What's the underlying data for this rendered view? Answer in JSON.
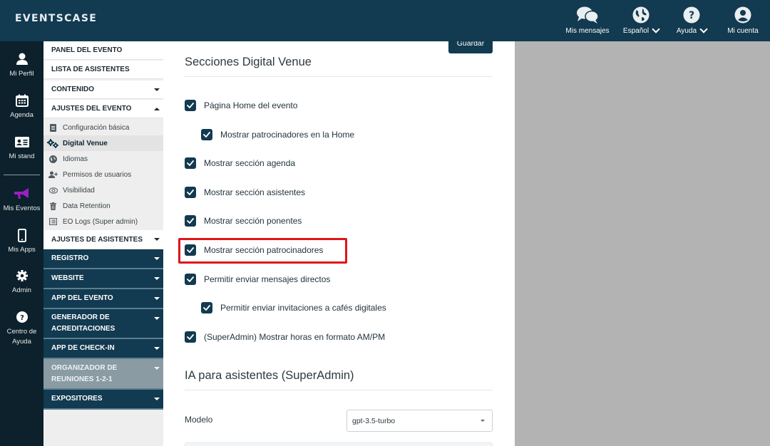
{
  "app": {
    "logo": "EVENTSCASE"
  },
  "topnav": [
    {
      "label": "Mis mensajes",
      "icon": "chat-bubbles-icon",
      "has_dropdown": false
    },
    {
      "label": "Español",
      "icon": "globe-icon",
      "has_dropdown": true
    },
    {
      "label": "Ayuda",
      "icon": "question-circle-icon",
      "has_dropdown": true
    },
    {
      "label": "Mi cuenta",
      "icon": "user-circle-icon",
      "has_dropdown": false
    }
  ],
  "leftrail": [
    {
      "label": "Mi Perfil",
      "icon": "user-icon"
    },
    {
      "label": "Agenda",
      "icon": "calendar-icon"
    },
    {
      "label": "Mi stand",
      "icon": "id-card-icon"
    },
    {
      "label": "Mis Eventos",
      "icon": "megaphone-icon",
      "active": true,
      "accent": "#9b1fc4"
    },
    {
      "label": "Mis Apps",
      "icon": "mobile-icon"
    },
    {
      "label": "Admin",
      "icon": "gear-icon"
    },
    {
      "label": "Centro de Ayuda",
      "icon": "question-circle-icon"
    }
  ],
  "sidenav": {
    "headers": [
      {
        "label": "PANEL DEL EVENTO"
      },
      {
        "label": "LISTA DE ASISTENTES"
      },
      {
        "label": "CONTENIDO",
        "expandable": true,
        "expanded": false
      },
      {
        "label": "AJUSTES DEL EVENTO",
        "expandable": true,
        "expanded": true
      }
    ],
    "subitems": [
      {
        "label": "Configuración básica",
        "icon": "document-icon"
      },
      {
        "label": "Digital Venue",
        "icon": "gears-icon",
        "active": true
      },
      {
        "label": "Idiomas",
        "icon": "globe-icon"
      },
      {
        "label": "Permisos de usuarios",
        "icon": "user-plus-icon"
      },
      {
        "label": "Visibilidad",
        "icon": "eye-icon"
      },
      {
        "label": "Data Retention",
        "icon": "trash-icon"
      },
      {
        "label": "EO Logs (Super admin)",
        "icon": "list-icon"
      }
    ],
    "asistentes_header": {
      "label": "AJUSTES DE ASISTENTES"
    },
    "dark_sections": [
      {
        "label": "REGISTRO"
      },
      {
        "label": "WEBSITE"
      },
      {
        "label": "APP DEL EVENTO"
      },
      {
        "label": "GENERADOR DE ACREDITACIONES"
      },
      {
        "label": "APP DE CHECK-IN"
      },
      {
        "label": "ORGANIZADOR DE REUNIONES 1-2-1",
        "disabled": true
      },
      {
        "label": "EXPOSITORES"
      }
    ]
  },
  "main": {
    "save_label": "Guardar",
    "section1_title": "Secciones Digital Venue",
    "options": [
      {
        "label": "Página Home del evento",
        "checked": true,
        "indent": 0
      },
      {
        "label": "Mostrar patrocinadores en la Home",
        "checked": true,
        "indent": 1
      },
      {
        "label": "Mostrar sección agenda",
        "checked": true,
        "indent": 0
      },
      {
        "label": "Mostrar sección asistentes",
        "checked": true,
        "indent": 0
      },
      {
        "label": "Mostrar sección ponentes",
        "checked": true,
        "indent": 0
      },
      {
        "label": "Mostrar sección patrocinadores",
        "checked": true,
        "indent": 0,
        "highlighted": true
      },
      {
        "label": "Permitir enviar mensajes directos",
        "checked": true,
        "indent": 0
      },
      {
        "label": "Permitir enviar invitaciones a cafés digitales",
        "checked": true,
        "indent": 1
      },
      {
        "label": "(SuperAdmin) Mostrar horas en formato AM/PM",
        "checked": true,
        "indent": 0
      }
    ],
    "section2_title": "IA para asistentes (SuperAdmin)",
    "model_label": "Modelo",
    "model_value": "gpt-3.5-turbo"
  },
  "colors": {
    "primary": "#123a50",
    "rail": "#0c212b",
    "highlight": "#e0141a",
    "accent": "#9b1fc4"
  }
}
